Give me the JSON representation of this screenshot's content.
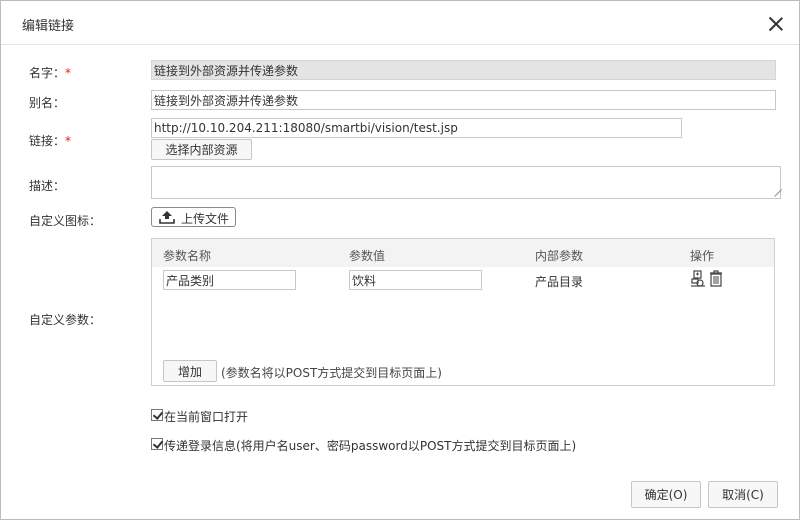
{
  "dialog": {
    "title": "编辑链接"
  },
  "form": {
    "name_label": "名字：",
    "name_required": "*",
    "name_value": "链接到外部资源并传递参数",
    "alias_label": "别名：",
    "alias_value": "链接到外部资源并传递参数",
    "link_label": "链接：",
    "link_required": "*",
    "link_value": "http://10.10.204.211:18080/smartbi/vision/test.jsp",
    "choose_internal_button": "选择内部资源",
    "desc_label": "描述：",
    "desc_value": "",
    "icon_label": "自定义图标：",
    "upload_button": "上传文件",
    "params_label": "自定义参数："
  },
  "params_table": {
    "headers": [
      "参数名称",
      "参数值",
      "内部参数",
      "操作"
    ],
    "rows": [
      {
        "name": "产品类别",
        "value": "饮料",
        "internal": "产品目录"
      }
    ],
    "add_button": "增加",
    "note": "(参数名将以POST方式提交到目标页面上)"
  },
  "options": {
    "open_current_window": {
      "label": "在当前窗口打开",
      "checked": true
    },
    "pass_login_info": {
      "label": "传递登录信息(将用户名user、密码password以POST方式提交到目标页面上)",
      "checked": true
    }
  },
  "footer": {
    "ok_button": "确定(O)",
    "cancel_button": "取消(C)"
  },
  "icons": [
    "close-icon",
    "upload-icon",
    "edit-param-icon",
    "trash-icon"
  ]
}
